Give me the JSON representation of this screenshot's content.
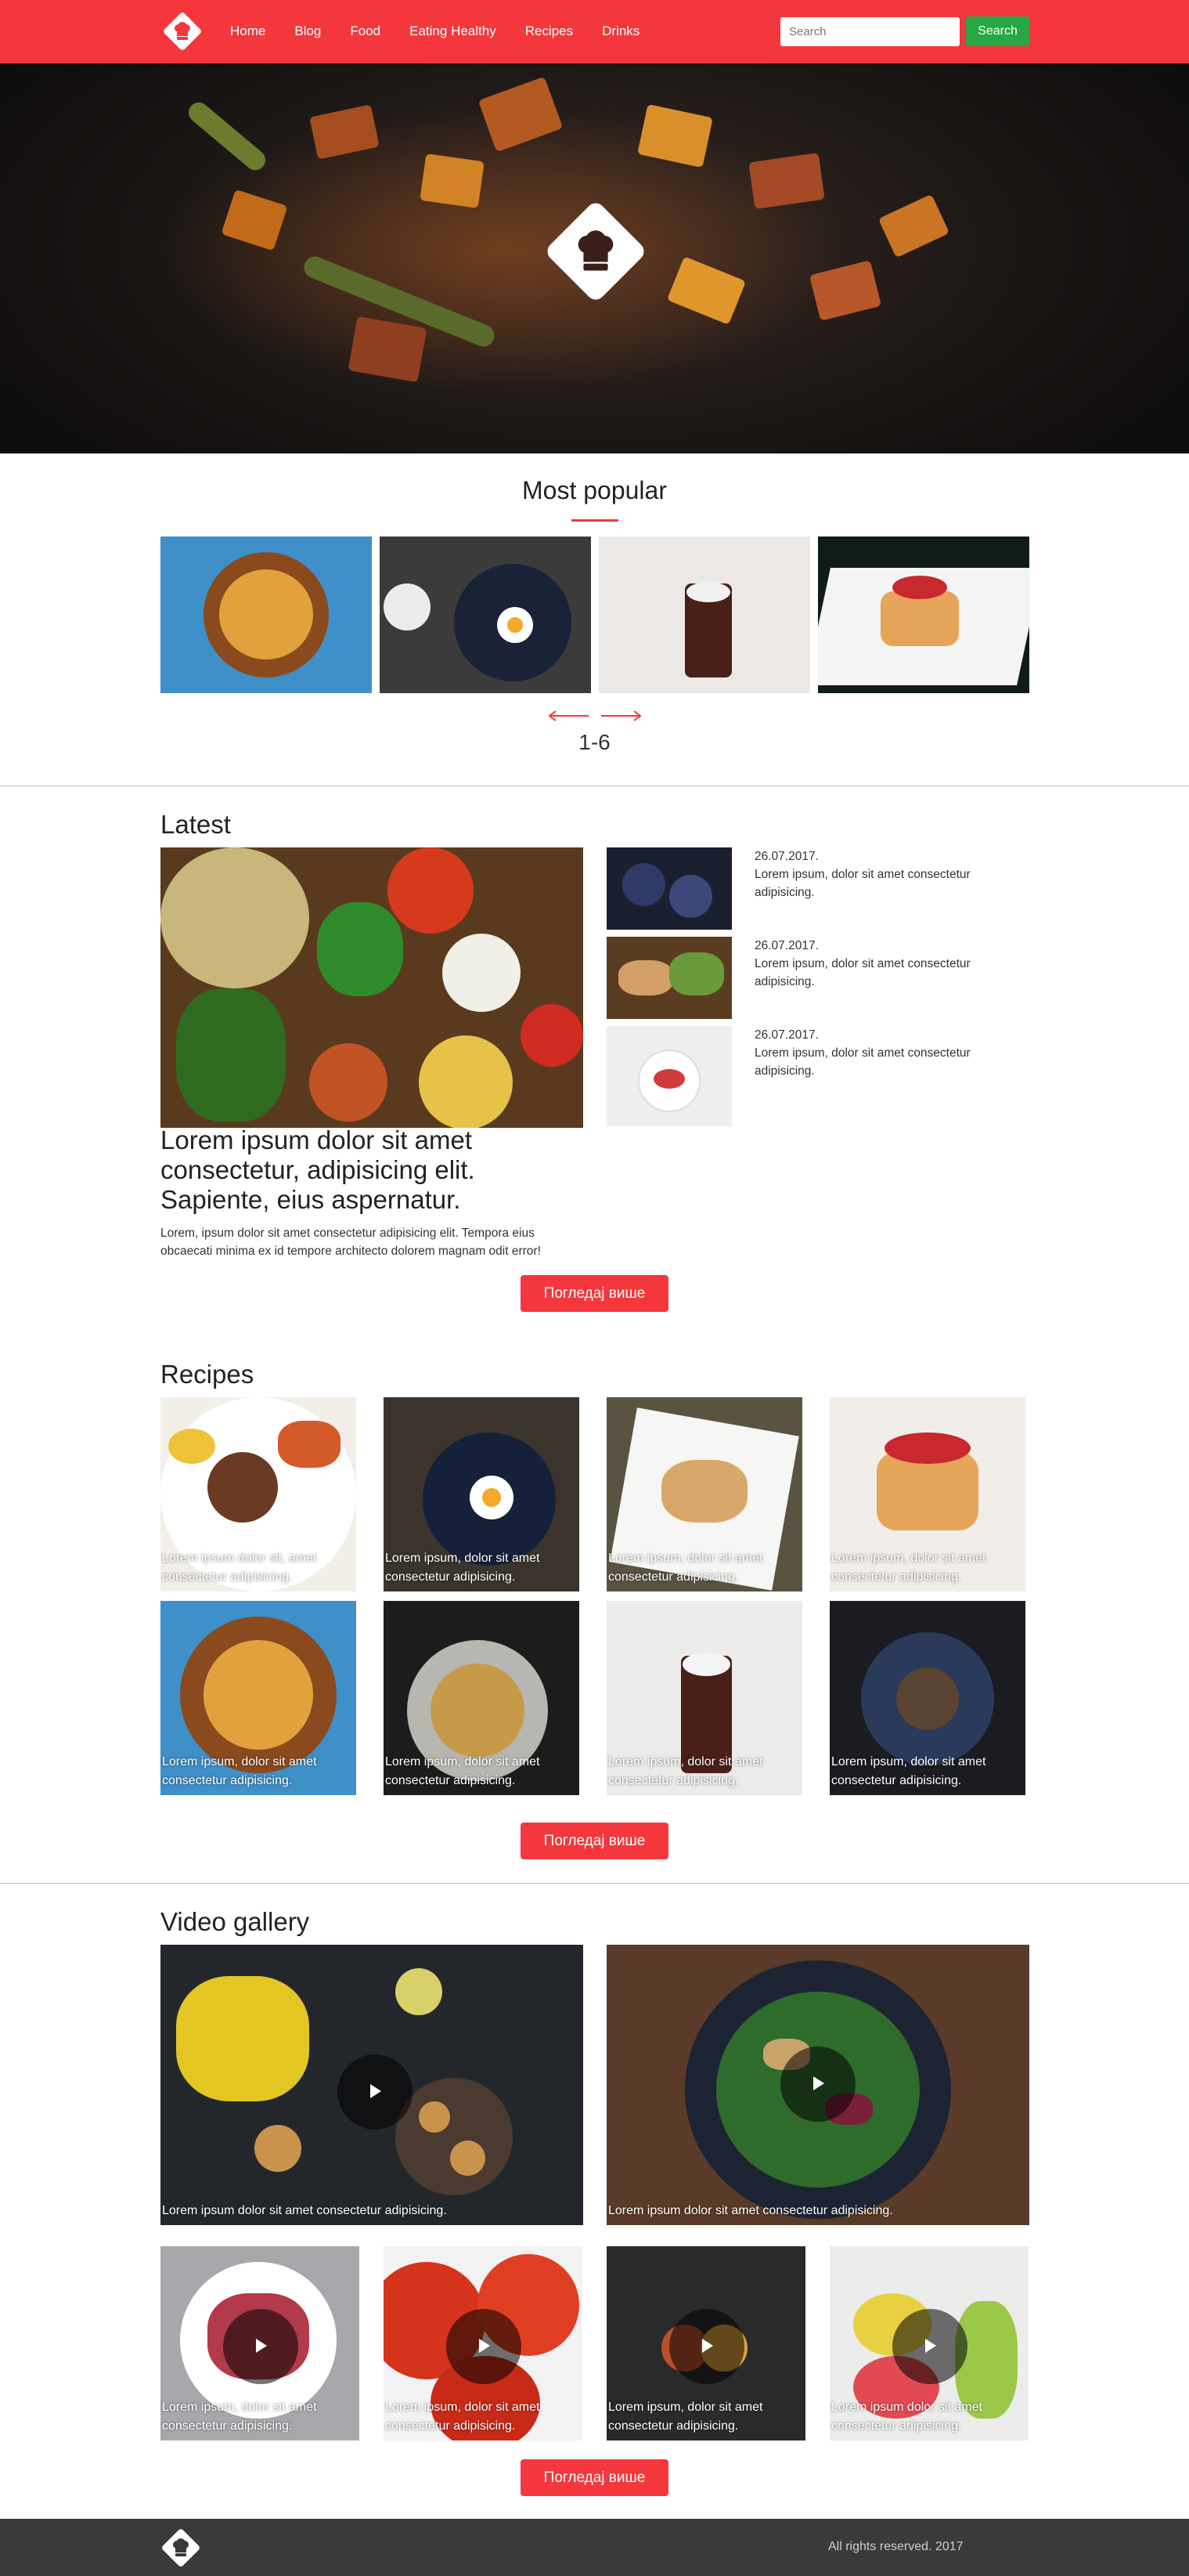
{
  "nav": {
    "menu": [
      "Home",
      "Blog",
      "Food",
      "Eating Healthy",
      "Recipes",
      "Drinks"
    ],
    "search_placeholder": "Search",
    "search_button": "Search",
    "logo_icon": "chef-hat-icon"
  },
  "colors": {
    "brand_red": "#f4373c",
    "search_green": "#28a745",
    "footer_gray": "#3a3a3a"
  },
  "most_popular": {
    "title": "Most popular",
    "pager": "1-6"
  },
  "latest": {
    "title": "Latest",
    "heading": "Lorem ipsum dolor sit amet consectetur, adipisicing elit. Sapiente, eius aspernatur.",
    "description": "Lorem, ipsum dolor sit amet consectetur adipisicing elit. Tempora eius obcaecati minima ex id tempore architecto dolorem magnam odit error!",
    "side_items": [
      {
        "date": "26.07.2017.",
        "text": "Lorem ipsum, dolor sit amet consectetur adipisicing."
      },
      {
        "date": "26.07.2017.",
        "text": "Lorem ipsum, dolor sit amet consectetur adipisicing."
      },
      {
        "date": "26.07.2017.",
        "text": "Lorem ipsum, dolor sit amet consectetur adipisicing."
      }
    ],
    "more_button": "Погледај више"
  },
  "recipes": {
    "title": "Recipes",
    "captions": [
      "Lorem ipsum dolor sit, amet consectetur adipisicing.",
      "Lorem ipsum, dolor sit amet consectetur adipisicing.",
      "Lorem ipsum, dolor sit amet consectetur adipisicing.",
      "Lorem ipsum, dolor sit amet consectetur adipisicing.",
      "Lorem ipsum, dolor sit amet consectetur adipisicing.",
      "Lorem ipsum, dolor sit amet consectetur adipisicing.",
      "Lorem ipsum, dolor sit amet consectetur adipisicing.",
      "Lorem ipsum, dolor sit amet consectetur adipisicing."
    ],
    "more_button": "Погледај више"
  },
  "video_gallery": {
    "title": "Video gallery",
    "big_captions": [
      "Lorem ipsum dolor sit amet consectetur adipisicing.",
      "Lorem ipsum dolor sit amet consectetur adipisicing."
    ],
    "small_captions": [
      "Lorem ipsum, dolor sit amet consectetur adipisicing.",
      "Lorem ipsum, dolor sit amet consectetur adipisicing.",
      "Lorem ipsum, dolor sit amet consectetur adipisicing.",
      "Lorem ipsum dolor sit amet consectetur adipisicing."
    ],
    "more_button": "Погледај више"
  },
  "footer": {
    "copyright": "All rights reserved. 2017"
  }
}
